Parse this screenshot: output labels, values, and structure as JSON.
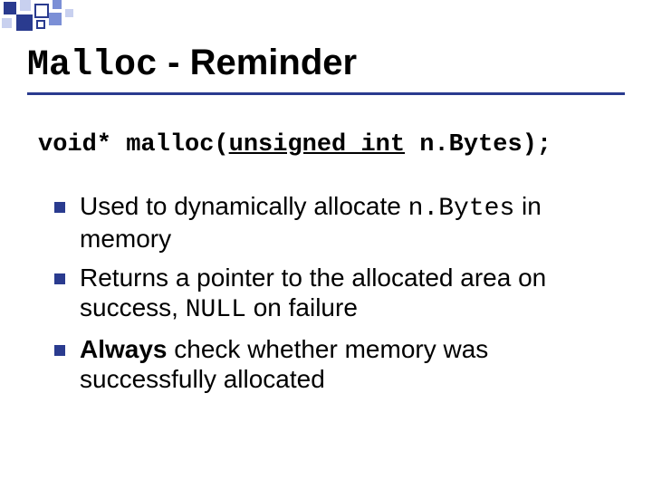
{
  "title": {
    "code": "Malloc",
    "rest": " - Reminder"
  },
  "signature": {
    "ret": "void*",
    "space1": " ",
    "fn": "malloc(",
    "arg_kw": "unsigned int",
    "arg_rest": " n.Bytes);"
  },
  "bullets": [
    {
      "pre": "Used to dynamically allocate ",
      "code": "n.Bytes",
      "post": " in memory"
    },
    {
      "pre": "Returns a pointer to the allocated area on success, ",
      "code": "NULL",
      "post": " on failure"
    },
    {
      "bold": "Always",
      "rest": " check whether memory was successfully allocated"
    }
  ]
}
